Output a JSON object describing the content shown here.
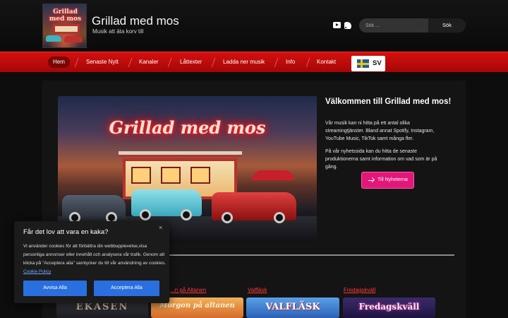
{
  "header": {
    "title": "Grillad med mos",
    "tagline": "Musik att äta korv till",
    "logo_text": "Grillad med mos",
    "social_icons": [
      "youtube-icon",
      "rss-icon"
    ],
    "search": {
      "placeholder": "Sök ...",
      "button_label": "Sök"
    }
  },
  "nav": {
    "items": [
      {
        "label": "Hem",
        "active": true
      },
      {
        "label": "Senaste Nytt"
      },
      {
        "label": "Kanaler"
      },
      {
        "label": "Låttexter"
      },
      {
        "label": "Ladda ner musik"
      },
      {
        "label": "Info"
      },
      {
        "label": "Kontakt"
      }
    ],
    "language": {
      "label": "SV",
      "flag": "sweden-flag"
    }
  },
  "hero": {
    "sign_text": "Grillad med mos"
  },
  "welcome": {
    "title": "Välkommen till Grillad med mos!",
    "paragraph1": "Vår musik kan ni hitta på ett antal olika streamingtjänster. Bland annat Spotify, Instagram, YouTube Music, TikTok samt många fler.",
    "paragraph2": "På vår nyhetssida kan du hitta de senaste produktionerna samt information om vad som är på gång.",
    "button_label": "Till Nyheterna"
  },
  "cards": [
    {
      "title": "",
      "thumb_text": "EKÅSEN"
    },
    {
      "title": "...n på Altanen",
      "thumb_text": "Morgon på altanen"
    },
    {
      "title": "Valfläsk",
      "thumb_text": "VALFLÄSK"
    },
    {
      "title": "Fredagskväll",
      "thumb_text": "Fredagskväll"
    }
  ],
  "cookie": {
    "title": "Får det lov att vara en kaka?",
    "close": "×",
    "body": "Vi använder cookies för att förbättra din webbupplevelse,visa personliga annonser eller innehåll och analysera vår trafik. Genom att klicka på \"Acceptera alla\" samtycker du till vår användning av cookies.",
    "link": "Cookie Policy",
    "deny_label": "Avvisa Alla",
    "accept_label": "Acceptera Alla"
  },
  "colors": {
    "nav_red": "#c80c0c",
    "button_pink": "#e3177a",
    "cookie_blue": "#2a6fe0",
    "card_title_red": "#ff3a3a"
  }
}
